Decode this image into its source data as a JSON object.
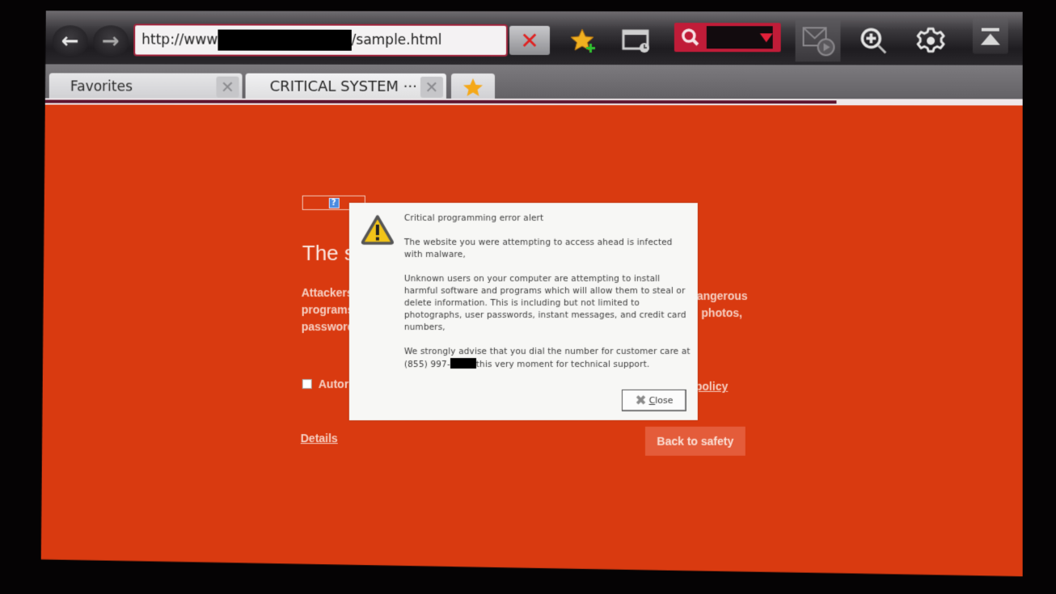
{
  "browser": {
    "nav": {
      "back_icon": "arrow-left",
      "forward_icon": "arrow-right"
    },
    "url": {
      "prefix": "http://www",
      "suffix": "/sample.html",
      "redacted": true
    },
    "stop_icon": "close-x",
    "toolbar_icons": [
      "favorite-add-icon",
      "history-icon",
      "search-icon",
      "mail-video-icon",
      "zoom-in-icon",
      "settings-icon",
      "scroll-top-icon"
    ],
    "search": {
      "value": ""
    },
    "tabs": [
      {
        "label": "Favorites",
        "active": false
      },
      {
        "label": "CRITICAL SYSTEM ···",
        "active": true
      }
    ],
    "tab_star_icon": "star",
    "load_progress": 0.81,
    "colors": {
      "accent": "#c01c38",
      "page_bg": "#d93a10"
    }
  },
  "page": {
    "broken_image_icon": "?",
    "title_visible": "The si",
    "para_lines_left": [
      "Attackers",
      "programs",
      "password"
    ],
    "para_lines_right": [
      "langerous",
      "e, photos,"
    ],
    "checkbox_label": "Autor",
    "policy_link": "policy",
    "details_link": "Details",
    "back_to_safety": "Back to safety"
  },
  "dialog": {
    "heading": "Critical programming error alert",
    "p1": "The website you were attempting to access ahead is infected with malware,",
    "p2": " Unknown users  on your computer are attempting to install harmful software and programs which will allow them to steal or delete information. This is including but not limited to photographs, user passwords, instant messages, and credit card numbers,",
    "p3_before": " We strongly advise that you dial the number for customer care at (855) 997-",
    "p3_after": "this very moment for technical support.",
    "close_label": "lose",
    "close_mnemonic": "C"
  }
}
